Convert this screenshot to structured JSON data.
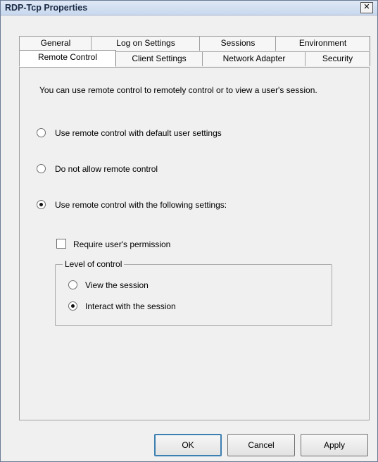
{
  "window": {
    "title": "RDP-Tcp Properties",
    "close_glyph": "✕"
  },
  "tabs_row_top": [
    "General",
    "Log on Settings",
    "Sessions",
    "Environment"
  ],
  "tabs_row_bottom": [
    "Remote Control",
    "Client Settings",
    "Network Adapter",
    "Security"
  ],
  "active_tab": "Remote Control",
  "content": {
    "description": "You can use remote control to remotely control or to view a user's session.",
    "options": [
      {
        "label": "Use remote control with default user settings",
        "selected": false
      },
      {
        "label": "Do not allow remote control",
        "selected": false
      },
      {
        "label": "Use remote control with the following settings:",
        "selected": true
      }
    ],
    "require_permission": {
      "label": "Require user's permission",
      "checked": false
    },
    "level_of_control": {
      "label": "Level of control",
      "options": [
        {
          "label": "View the session",
          "selected": false
        },
        {
          "label": "Interact with the session",
          "selected": true
        }
      ]
    }
  },
  "buttons": {
    "ok": "OK",
    "cancel": "Cancel",
    "apply": "Apply"
  }
}
